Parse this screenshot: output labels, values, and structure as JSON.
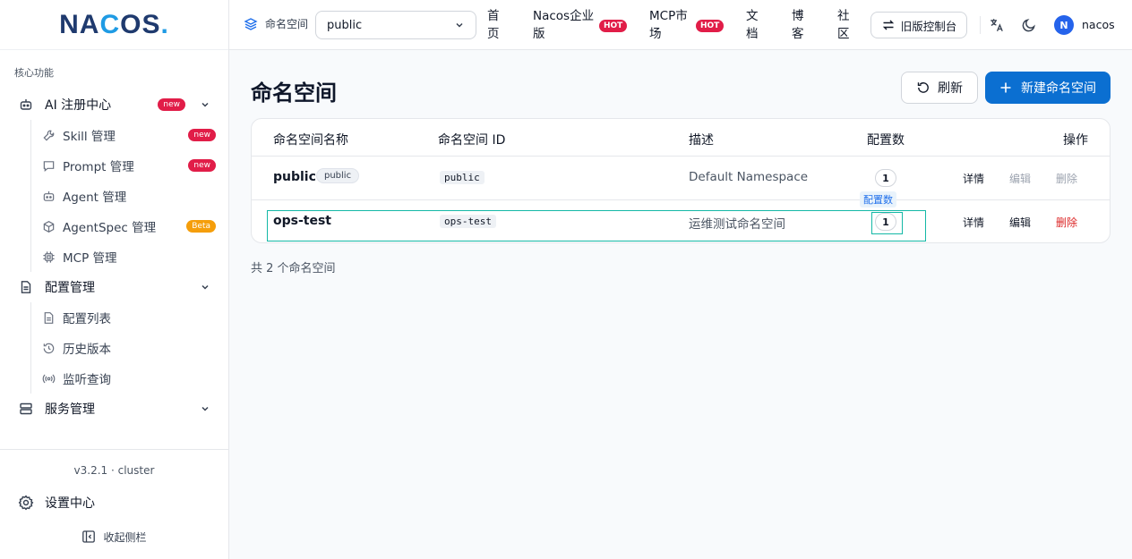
{
  "logo": {
    "text_a": "NA",
    "text_b": "C",
    "text_c": "OS",
    "dot": "."
  },
  "sidebar": {
    "section_label": "核心功能",
    "groups": [
      {
        "label": "AI 注册中心",
        "badge": "new",
        "icon": "robot-icon"
      },
      {
        "label": "配置管理",
        "icon": "document-icon"
      },
      {
        "label": "服务管理",
        "icon": "server-icon"
      }
    ],
    "ai_items": [
      {
        "label": "Skill 管理",
        "badge": "new",
        "icon": "wrench-icon"
      },
      {
        "label": "Prompt 管理",
        "badge": "new",
        "icon": "chat-icon"
      },
      {
        "label": "Agent 管理",
        "icon": "robot-icon"
      },
      {
        "label": "AgentSpec 管理",
        "badge": "Beta",
        "icon": "cube-icon"
      },
      {
        "label": "MCP 管理",
        "icon": "chip-icon"
      }
    ],
    "config_items": [
      {
        "label": "配置列表",
        "icon": "file-icon"
      },
      {
        "label": "历史版本",
        "icon": "history-icon"
      },
      {
        "label": "监听查询",
        "icon": "broadcast-icon"
      }
    ],
    "version": "v3.2.1 · cluster",
    "settings": "设置中心",
    "collapse": "收起侧栏"
  },
  "topbar": {
    "namespace_label": "命名空间",
    "namespace_value": "public",
    "nav": [
      {
        "label_1": "首",
        "label_2": "页"
      },
      {
        "label_1": "Nacos企业",
        "label_2": "版",
        "badge": "HOT"
      },
      {
        "label_1": "MCP市",
        "label_2": "场",
        "badge": "HOT"
      },
      {
        "label_1": "文",
        "label_2": "档"
      },
      {
        "label_1": "博",
        "label_2": "客"
      },
      {
        "label_1": "社",
        "label_2": "区"
      }
    ],
    "legacy_console": "旧版控制台",
    "user_initial": "N",
    "username": "nacos"
  },
  "main": {
    "title": "命名空间",
    "refresh": "刷新",
    "create": "新建命名空间",
    "columns": [
      "命名空间名称",
      "命名空间 ID",
      "描述",
      "配置数",
      "操作"
    ],
    "rows": [
      {
        "name": "public",
        "tag": "public",
        "id": "public",
        "desc": "Default Namespace",
        "count": "1",
        "actions": [
          "详情",
          "编辑",
          "删除"
        ]
      },
      {
        "name": "ops-test",
        "id": "ops-test",
        "desc": "运维测试命名空间",
        "count": "1",
        "actions": [
          "详情",
          "编辑",
          "删除"
        ]
      }
    ],
    "tooltip": "配置数",
    "summary": "共 2 个命名空间"
  },
  "colors": {
    "primary": "#0b6fd1",
    "danger": "#dc2626",
    "badge": "#e11d48",
    "beta": "#f59e0b",
    "highlight": "#14b8a6"
  }
}
